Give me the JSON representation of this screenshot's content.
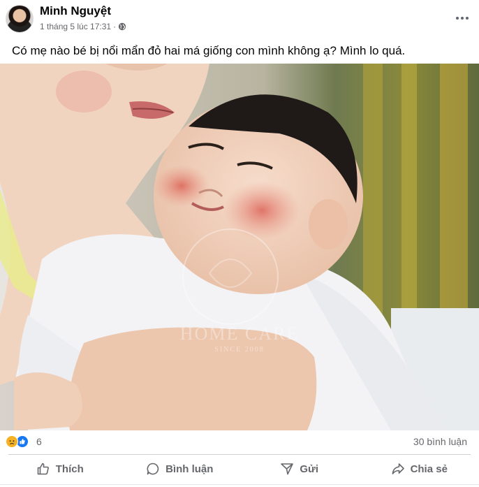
{
  "post": {
    "author": "Minh Nguyệt",
    "timestamp": "1 tháng 5 lúc 17:31",
    "separator": "·",
    "privacy_icon": "globe-icon",
    "caption": "Có mẹ nào bé bị nổi mẩn đỏ hai má giống con mình không ạ? Mình lo quá.",
    "image": {
      "watermark_brand": "HOME CARE",
      "watermark_since": "SINCE 2008"
    }
  },
  "stats": {
    "reaction_icons": [
      "sad-reaction-icon",
      "like-reaction-icon"
    ],
    "reaction_count": "6",
    "comments": "30 bình luận"
  },
  "actions": {
    "like": "Thích",
    "comment": "Bình luận",
    "send": "Gửi",
    "share": "Chia sẻ"
  },
  "colors": {
    "secondary_text": "#65676b",
    "like_blue": "#1877f2",
    "sad_yellow": "#f7b125"
  }
}
